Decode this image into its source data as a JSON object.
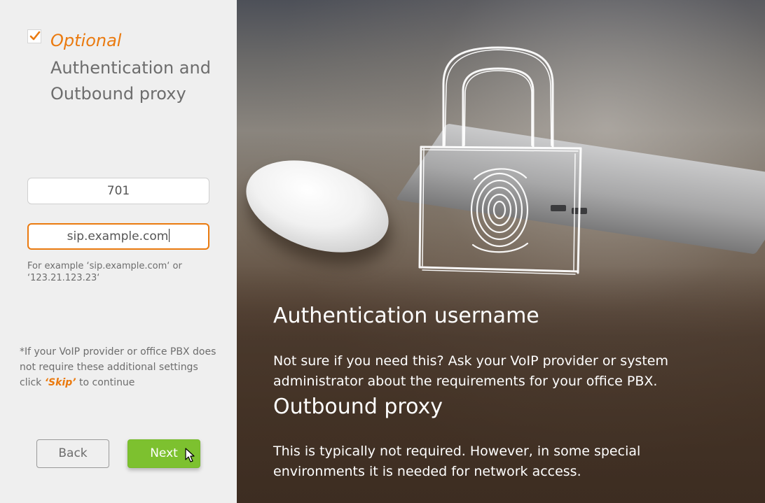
{
  "step": {
    "checked": true,
    "optional_label": "Optional",
    "title": "Authentication and Outbound proxy"
  },
  "fields": {
    "auth_username": {
      "value": "701"
    },
    "outbound_proxy": {
      "value": "sip.example.com"
    }
  },
  "hint": "For example ‘sip.example.com‘ or ‘123.21.123.23‘",
  "skip_note": {
    "before": "*If your VoIP provider or office PBX does not require these additional settings click ",
    "skip": "‘Skip’",
    "after": " to continue"
  },
  "buttons": {
    "back": "Back",
    "next": "Next"
  },
  "info": {
    "heading_1": "Authentication username",
    "text_1": " Not sure if you need this? Ask your VoIP provider or system administrator about the requirements for your office PBX.",
    "heading_2": "Outbound proxy",
    "text_2": " This is typically not required. However, in some special environments it is needed for network access."
  },
  "colors": {
    "accent_orange": "#ea7a0f",
    "next_green": "#7dc12f"
  },
  "icons": {
    "check": "checkmark-icon",
    "lock": "padlock-fingerprint-icon",
    "cursor": "mouse-pointer-icon"
  }
}
